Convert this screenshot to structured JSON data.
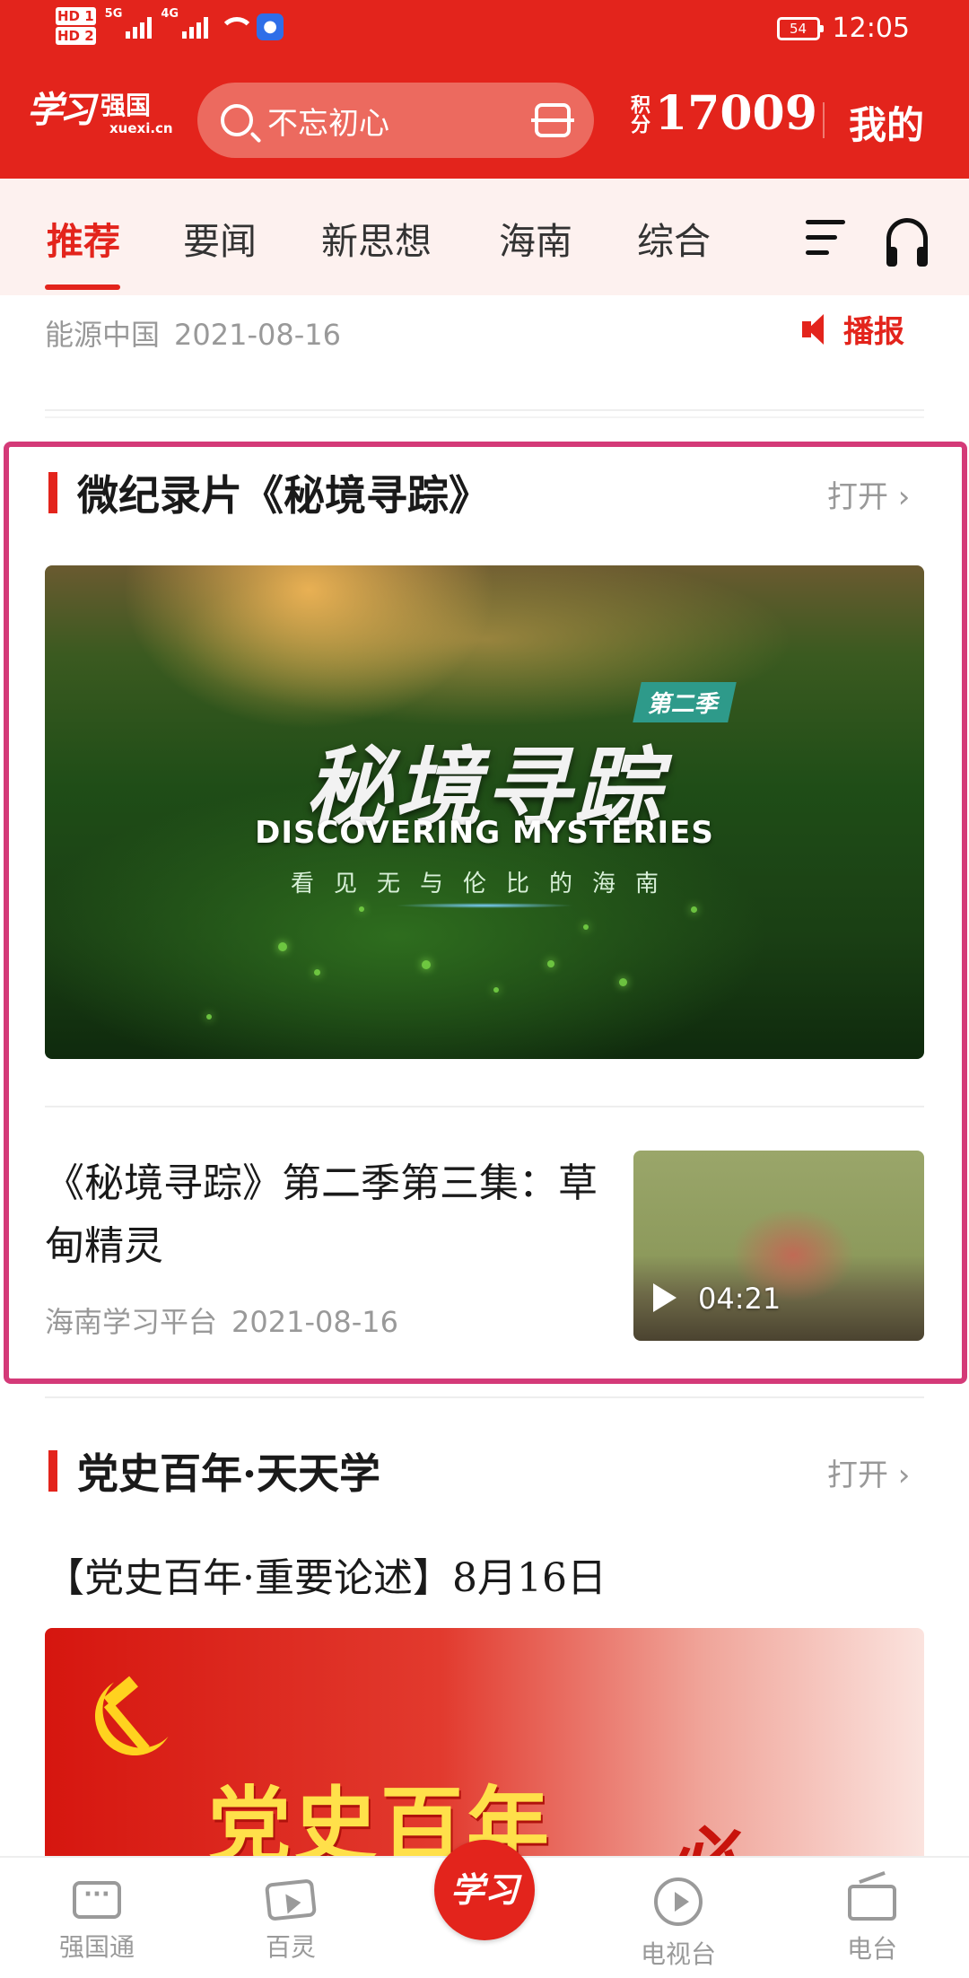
{
  "status_bar": {
    "hd1": "HD 1",
    "hd2": "HD 2",
    "net1": "5G",
    "net2": "4G",
    "battery": "54",
    "time": "12:05"
  },
  "header": {
    "logo_calligraphy": "学习",
    "logo_name": "强国",
    "logo_domain": "xuexi.cn",
    "search_placeholder": "不忘初心",
    "points_label": "积分",
    "points_value": "17009",
    "mine_label": "我的"
  },
  "tabs": [
    {
      "label": "推荐",
      "active": true
    },
    {
      "label": "要闻"
    },
    {
      "label": "新思想"
    },
    {
      "label": "海南"
    },
    {
      "label": "综合"
    }
  ],
  "prev_item": {
    "source": "能源中国",
    "date": "2021-08-16",
    "broadcast_label": "播报"
  },
  "section1": {
    "title": "微纪录片《秘境寻踪》",
    "open_label": "打开",
    "hero": {
      "season_badge": "第二季",
      "title": "秘境寻踪",
      "subtitle_en": "DISCOVERING MYSTERIES",
      "subtitle_cn": "看见无与伦比的海南"
    },
    "item": {
      "title": "《秘境寻踪》第二季第三集：草甸精灵",
      "source": "海南学习平台",
      "date": "2021-08-16",
      "duration": "04:21"
    }
  },
  "section2": {
    "title": "党史百年·天天学",
    "open_label": "打开",
    "item_title": "【党史百年·重要论述】8月16日",
    "banner_text": "党史百年",
    "banner_brush": "必"
  },
  "bottom_nav": [
    {
      "label": "强国通",
      "icon": "chat-icon"
    },
    {
      "label": "百灵",
      "icon": "video-icon"
    },
    {
      "label": "学习",
      "icon": "center-logo"
    },
    {
      "label": "电视台",
      "icon": "tv-play-icon"
    },
    {
      "label": "电台",
      "icon": "radio-icon"
    }
  ],
  "colors": {
    "brand_red": "#e3241c",
    "highlight_border": "#d43a78",
    "muted_text": "#999999"
  }
}
